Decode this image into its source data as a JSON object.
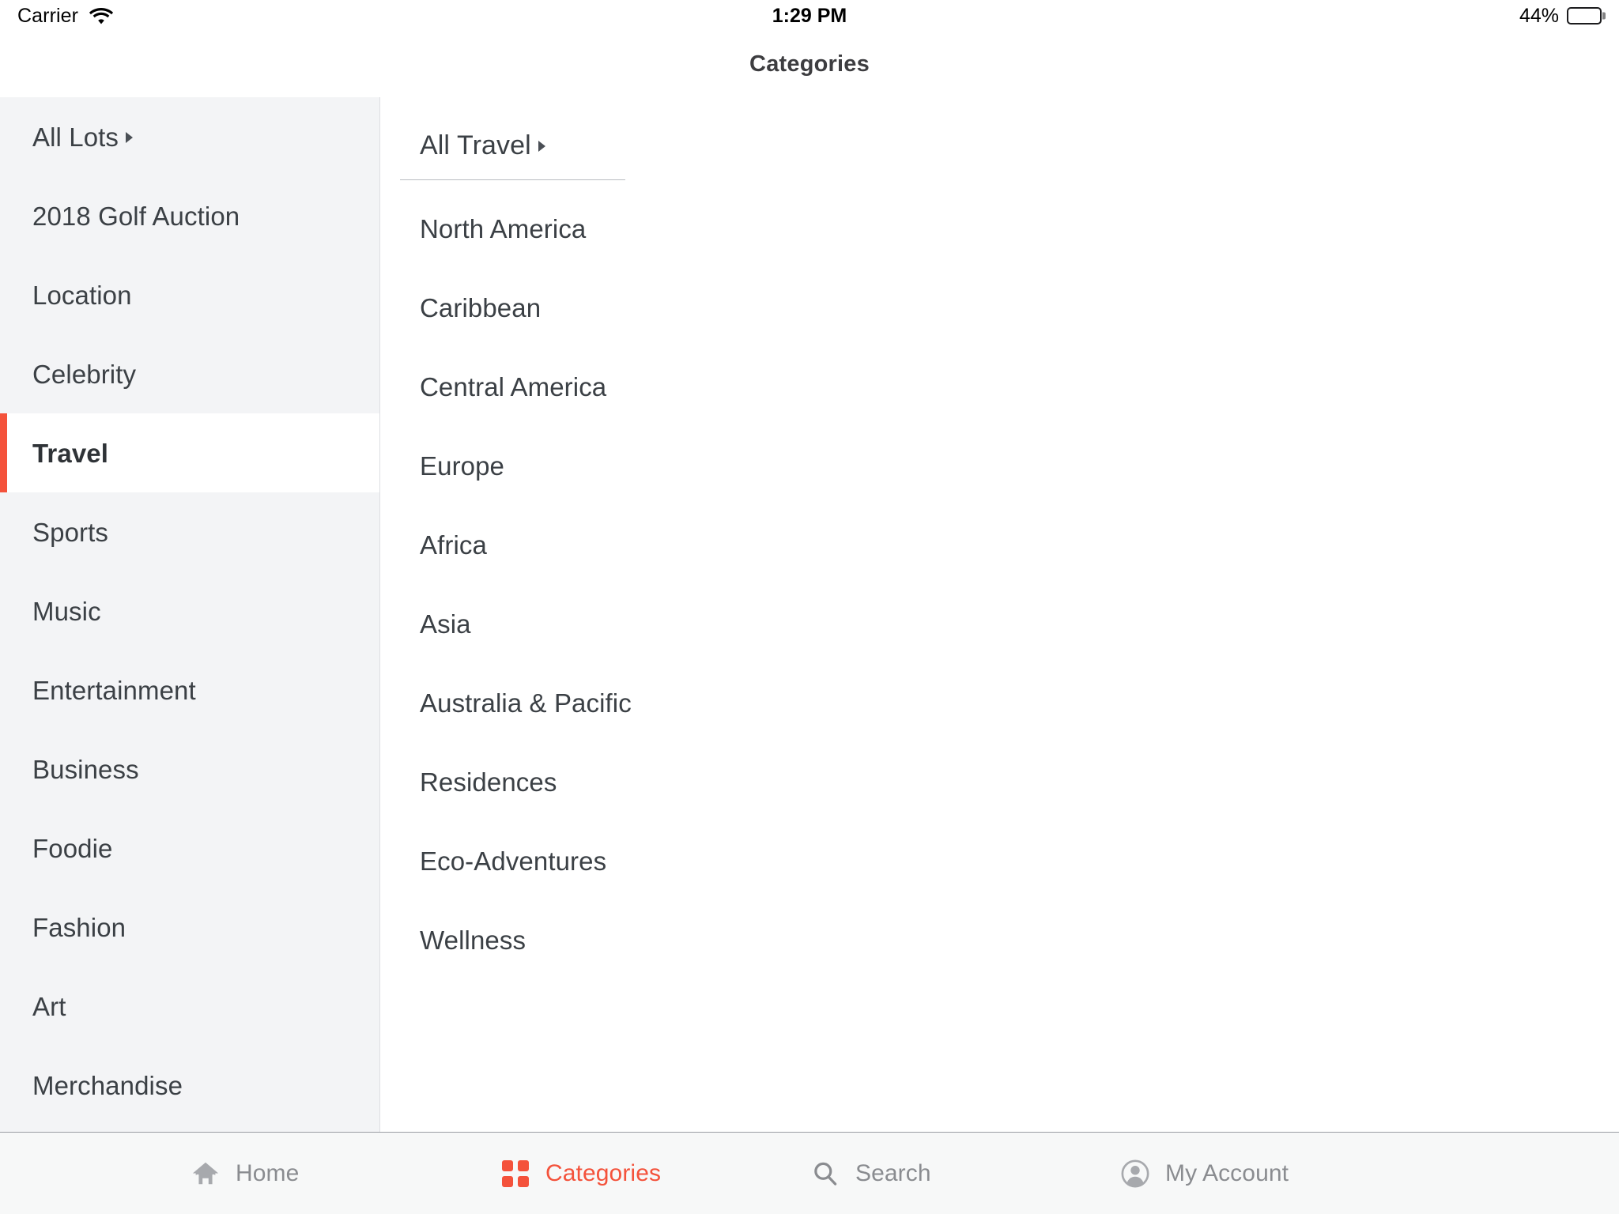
{
  "status_bar": {
    "carrier": "Carrier",
    "wifi_icon": "wifi-icon",
    "time": "1:29 PM",
    "battery_percent_label": "44%",
    "battery_level": 44
  },
  "nav_bar": {
    "title": "Categories"
  },
  "accent_color": "#f4523b",
  "sidebar": {
    "selected": "Travel",
    "items": [
      {
        "label": "All Lots",
        "has_caret": true
      },
      {
        "label": "2018 Golf Auction",
        "has_caret": false
      },
      {
        "label": "Location",
        "has_caret": false
      },
      {
        "label": "Celebrity",
        "has_caret": false
      },
      {
        "label": "Travel",
        "has_caret": false
      },
      {
        "label": "Sports",
        "has_caret": false
      },
      {
        "label": "Music",
        "has_caret": false
      },
      {
        "label": "Entertainment",
        "has_caret": false
      },
      {
        "label": "Business",
        "has_caret": false
      },
      {
        "label": "Foodie",
        "has_caret": false
      },
      {
        "label": "Fashion",
        "has_caret": false
      },
      {
        "label": "Art",
        "has_caret": false
      },
      {
        "label": "Merchandise",
        "has_caret": false
      }
    ]
  },
  "detail": {
    "header": {
      "label": "All Travel",
      "has_caret": true
    },
    "items": [
      {
        "label": "North America"
      },
      {
        "label": "Caribbean"
      },
      {
        "label": "Central America"
      },
      {
        "label": "Europe"
      },
      {
        "label": "Africa"
      },
      {
        "label": "Asia"
      },
      {
        "label": "Australia & Pacific"
      },
      {
        "label": "Residences"
      },
      {
        "label": "Eco-Adventures"
      },
      {
        "label": "Wellness"
      }
    ]
  },
  "tab_bar": {
    "active": "Categories",
    "tabs": [
      {
        "label": "Home",
        "icon": "home-icon"
      },
      {
        "label": "Categories",
        "icon": "grid-icon"
      },
      {
        "label": "Search",
        "icon": "search-icon"
      },
      {
        "label": "My Account",
        "icon": "account-icon"
      }
    ]
  }
}
